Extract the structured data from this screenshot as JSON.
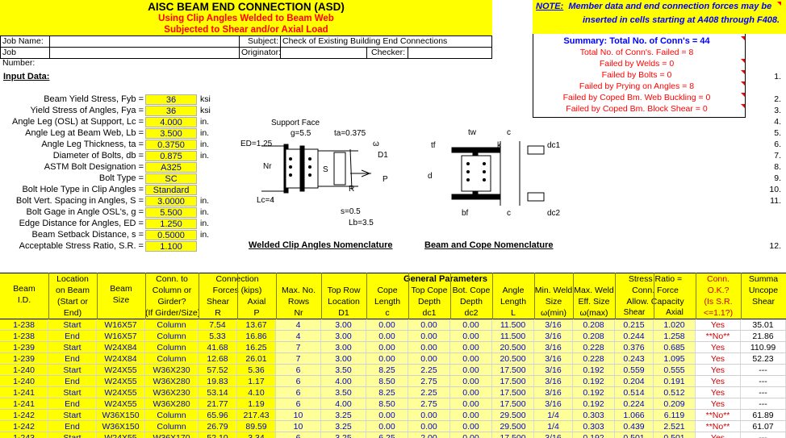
{
  "title": {
    "main": "AISC BEAM END CONNECTION (ASD)",
    "sub1": "Using Clip Angles Welded to Beam Web",
    "sub2": "Subjected to Shear and/or Axial Load"
  },
  "note": {
    "label": "NOTE:",
    "line1": "Member data and end connection forces may be",
    "line2": "inserted in cells starting at A408 through F408."
  },
  "job": {
    "job_name_label": "Job Name:",
    "job_number_label": "Job Number:",
    "subject_label": "Subject:",
    "subject_value": "Check of Existing Building End Connections",
    "originator_label": "Originator:",
    "checker_label": "Checker:"
  },
  "summary": {
    "title": "Summary:  Total No. of Conn's = 44",
    "lines": [
      "Total No. of Conn's. Failed = 8",
      "Failed by Welds = 0",
      "Failed by Bolts = 0",
      "Failed by Prying on Angles = 8",
      "Failed by Coped Bm. Web Buckling = 0",
      "Failed by Coped Bm. Block Shear = 0"
    ]
  },
  "input_header": "Input Data:",
  "inputs": [
    {
      "label": "Beam Yield Stress, Fyb =",
      "value": "36",
      "unit": "ksi"
    },
    {
      "label": "Yield Stress of Angles, Fya =",
      "value": "36",
      "unit": "ksi"
    },
    {
      "label": "Angle Leg (OSL) at Support, Lc =",
      "value": "4.000",
      "unit": "in."
    },
    {
      "label": "Angle Leg at Beam Web, Lb =",
      "value": "3.500",
      "unit": "in."
    },
    {
      "label": "Angle Leg Thickness, ta =",
      "value": "0.3750",
      "unit": "in."
    },
    {
      "label": "Diameter of Bolts, db =",
      "value": "0.875",
      "unit": "in."
    },
    {
      "label": "ASTM Bolt Designation =",
      "value": "A325",
      "unit": ""
    },
    {
      "label": "Bolt Type =",
      "value": "SC",
      "unit": ""
    },
    {
      "label": "Bolt Hole Type in Clip Angles =",
      "value": "Standard",
      "unit": ""
    },
    {
      "label": "Bolt Vert. Spacing in Angles, S =",
      "value": "3.0000",
      "unit": "in."
    },
    {
      "label": "Bolt Gage in Angle OSL's, g =",
      "value": "5.500",
      "unit": "in."
    },
    {
      "label": "Edge Distance for Angles, ED =",
      "value": "1.250",
      "unit": "in."
    },
    {
      "label": "Beam Setback Distance, s =",
      "value": "0.5000",
      "unit": "in."
    },
    {
      "label": "Acceptable Stress Ratio, S.R. =",
      "value": "1.100",
      "unit": ""
    }
  ],
  "row_numbers": [
    "1.",
    "2.",
    "3.",
    "4.",
    "5.",
    "6.",
    "7.",
    "8.",
    "9.",
    "10.",
    "11.",
    "12."
  ],
  "diagram1": {
    "caption": "Welded Clip Angles Nomenclature",
    "support_face": "Support Face",
    "g": "g=5.5",
    "ta": "ta=0.375",
    "ed": "ED=1.25",
    "nr": "Nr",
    "s_lbl": "S",
    "omega": "ω",
    "d1": "D1",
    "p": "P",
    "r": "R",
    "lc": "Lc=4",
    "s": "s=0.5",
    "lb": "Lb=3.5"
  },
  "diagram2": {
    "caption": "Beam and Cope Nomenclature",
    "tw": "tw",
    "c": "c",
    "tf": "tf",
    "k": "k",
    "dc1": "dc1",
    "d": "d",
    "bf": "bf",
    "dc2": "dc2"
  },
  "table": {
    "headers": {
      "beam_id": [
        "Beam",
        "I.D."
      ],
      "location": [
        "Location",
        "on Beam",
        "(Start or",
        "End)"
      ],
      "beam_size": [
        "Beam",
        "Size"
      ],
      "conn_to": [
        "Conn. to",
        "Column or",
        "Girder?",
        "(If Girder/Size)"
      ],
      "forces": [
        "Connection",
        "Forces (kips)"
      ],
      "shear": [
        "Shear",
        "R"
      ],
      "axial": [
        "Axial",
        "P"
      ],
      "general": "General Parameters",
      "max_rows": [
        "Max. No.",
        "Rows",
        "Nr"
      ],
      "top_row": [
        "Top Row",
        "Location",
        "D1"
      ],
      "cope_len": [
        "Cope",
        "Length",
        "c"
      ],
      "top_cope": [
        "Top Cope",
        "Depth",
        "dc1"
      ],
      "bot_cope": [
        "Bot. Cope",
        "Depth",
        "dc2"
      ],
      "angle_len": [
        "Angle",
        "Length",
        "L"
      ],
      "min_weld": [
        "Min. Weld",
        "Size",
        "ω(min)"
      ],
      "max_weld": [
        "Max. Weld",
        "Eff. Size",
        "ω(max)"
      ],
      "stress_ratio": [
        "Stress Ratio =",
        "Conn. Force",
        "Allow. Capacity"
      ],
      "sr_shear": "Shear",
      "sr_axial": "Axial",
      "conn_ok": [
        "Conn.",
        "O.K.?",
        "(Is S.R.",
        "<=1.1?)"
      ],
      "summa": [
        "Summa",
        "Uncope",
        "Shear"
      ]
    },
    "rows": [
      [
        "1-238",
        "Start",
        "W16X57",
        "Column",
        "7.54",
        "13.67",
        "4",
        "3.00",
        "0.00",
        "0.00",
        "0.00",
        "11.500",
        "3/16",
        "0.208",
        "0.215",
        "1.020",
        "Yes",
        "35.01"
      ],
      [
        "1-238",
        "End",
        "W16X57",
        "Column",
        "5.33",
        "16.86",
        "4",
        "3.00",
        "0.00",
        "0.00",
        "0.00",
        "11.500",
        "3/16",
        "0.208",
        "0.244",
        "1.258",
        "**No**",
        "21.86"
      ],
      [
        "1-239",
        "Start",
        "W24X84",
        "Column",
        "41.68",
        "16.25",
        "7",
        "3.00",
        "0.00",
        "0.00",
        "0.00",
        "20.500",
        "3/16",
        "0.228",
        "0.376",
        "0.685",
        "Yes",
        "110.99"
      ],
      [
        "1-239",
        "End",
        "W24X84",
        "Column",
        "12.68",
        "26.01",
        "7",
        "3.00",
        "0.00",
        "0.00",
        "0.00",
        "20.500",
        "3/16",
        "0.228",
        "0.243",
        "1.095",
        "Yes",
        "52.23"
      ],
      [
        "1-240",
        "Start",
        "W24X55",
        "W36X230",
        "57.52",
        "5.36",
        "6",
        "3.50",
        "8.25",
        "2.25",
        "0.00",
        "17.500",
        "3/16",
        "0.192",
        "0.559",
        "0.555",
        "Yes",
        "---"
      ],
      [
        "1-240",
        "End",
        "W24X55",
        "W36X280",
        "19.83",
        "1.17",
        "6",
        "4.00",
        "8.50",
        "2.75",
        "0.00",
        "17.500",
        "3/16",
        "0.192",
        "0.204",
        "0.191",
        "Yes",
        "---"
      ],
      [
        "1-241",
        "Start",
        "W24X55",
        "W36X230",
        "53.14",
        "4.10",
        "6",
        "3.50",
        "8.25",
        "2.25",
        "0.00",
        "17.500",
        "3/16",
        "0.192",
        "0.514",
        "0.512",
        "Yes",
        "---"
      ],
      [
        "1-241",
        "End",
        "W24X55",
        "W36X280",
        "21.77",
        "1.19",
        "6",
        "4.00",
        "8.50",
        "2.75",
        "0.00",
        "17.500",
        "3/16",
        "0.192",
        "0.224",
        "0.209",
        "Yes",
        "---"
      ],
      [
        "1-242",
        "Start",
        "W36X150",
        "Column",
        "65.96",
        "217.43",
        "10",
        "3.25",
        "0.00",
        "0.00",
        "0.00",
        "29.500",
        "1/4",
        "0.303",
        "1.066",
        "6.119",
        "**No**",
        "61.89"
      ],
      [
        "1-242",
        "End",
        "W36X150",
        "Column",
        "26.79",
        "89.59",
        "10",
        "3.25",
        "0.00",
        "0.00",
        "0.00",
        "29.500",
        "1/4",
        "0.303",
        "0.439",
        "2.521",
        "**No**",
        "61.07"
      ],
      [
        "1-243",
        "Start",
        "W24X55",
        "W36X170",
        "52.10",
        "3.34",
        "6",
        "3.25",
        "6.25",
        "2.00",
        "0.00",
        "17.500",
        "3/16",
        "0.192",
        "0.501",
        "0.501",
        "Yes",
        "---"
      ]
    ]
  }
}
